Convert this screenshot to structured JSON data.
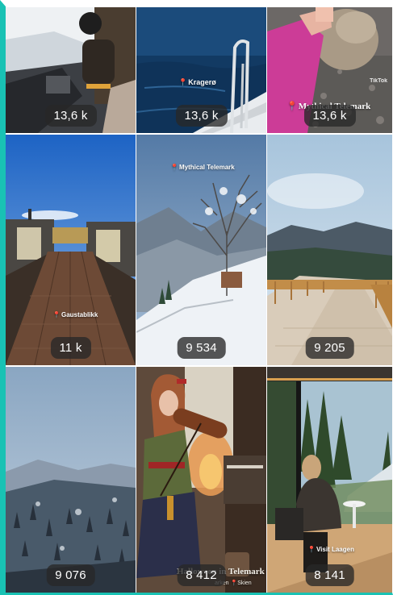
{
  "tiles": [
    {
      "id": "tile-1",
      "views": "13,6 k",
      "thumb_subject": "snowmobile-driver"
    },
    {
      "id": "tile-2",
      "views": "13,6 k",
      "thumb_subject": "boat-bow-sea",
      "location": "Kragerø"
    },
    {
      "id": "tile-3",
      "views": "13,6 k",
      "thumb_subject": "hand-petting-sheep",
      "location": "Mythical Telemark",
      "watermark": "TikTok"
    },
    {
      "id": "tile-4",
      "views": "11 k",
      "thumb_subject": "wooden-pier-cabins",
      "location": "Gaustablikk"
    },
    {
      "id": "tile-5",
      "views": "9 534",
      "thumb_subject": "snowy-tree-mountains",
      "location": "Mythical Telemark"
    },
    {
      "id": "tile-6",
      "views": "9 205",
      "thumb_subject": "wooden-boardwalk-valley"
    },
    {
      "id": "tile-7",
      "views": "9 076",
      "thumb_subject": "snowy-forest-mountain"
    },
    {
      "id": "tile-8",
      "views": "8 412",
      "thumb_subject": "violinist-folk-costume",
      "caption": "Halloween in Telemark",
      "subcaption_left": "arken",
      "subcaption_location": "Skien"
    },
    {
      "id": "tile-9",
      "views": "8 141",
      "thumb_subject": "woman-glass-cabin-river",
      "location": "Visit Laagen"
    }
  ],
  "colors": {
    "accent_border": "#19c2b4",
    "badge_bg": "#282828",
    "pin": "#e23b3b"
  }
}
